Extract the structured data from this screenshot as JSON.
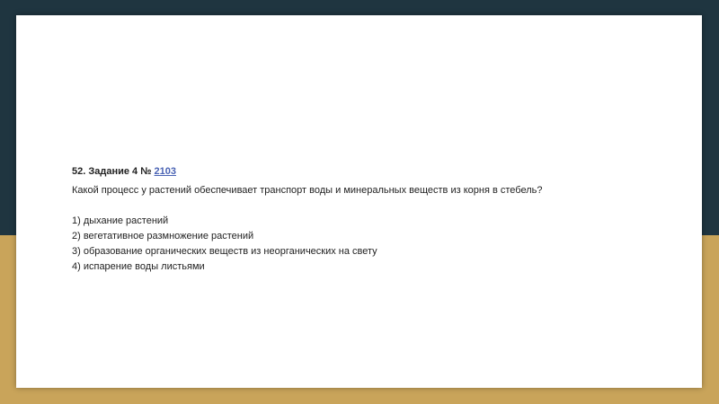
{
  "task": {
    "prefix": "52. Задание 4 № ",
    "number_link": "2103",
    "question": "Какой процесс у растений обеспечивает транспорт воды и минеральных веществ из корня в стебель?",
    "answers": [
      "1) дыхание растений",
      "2) вегетативное размножение растений",
      "3) образование органических веществ из неорганических на свету",
      "4) испарение воды листьями"
    ]
  },
  "colors": {
    "dark_band": "#1f3540",
    "gold_band": "#c9a45a",
    "link": "#4a63b4"
  }
}
